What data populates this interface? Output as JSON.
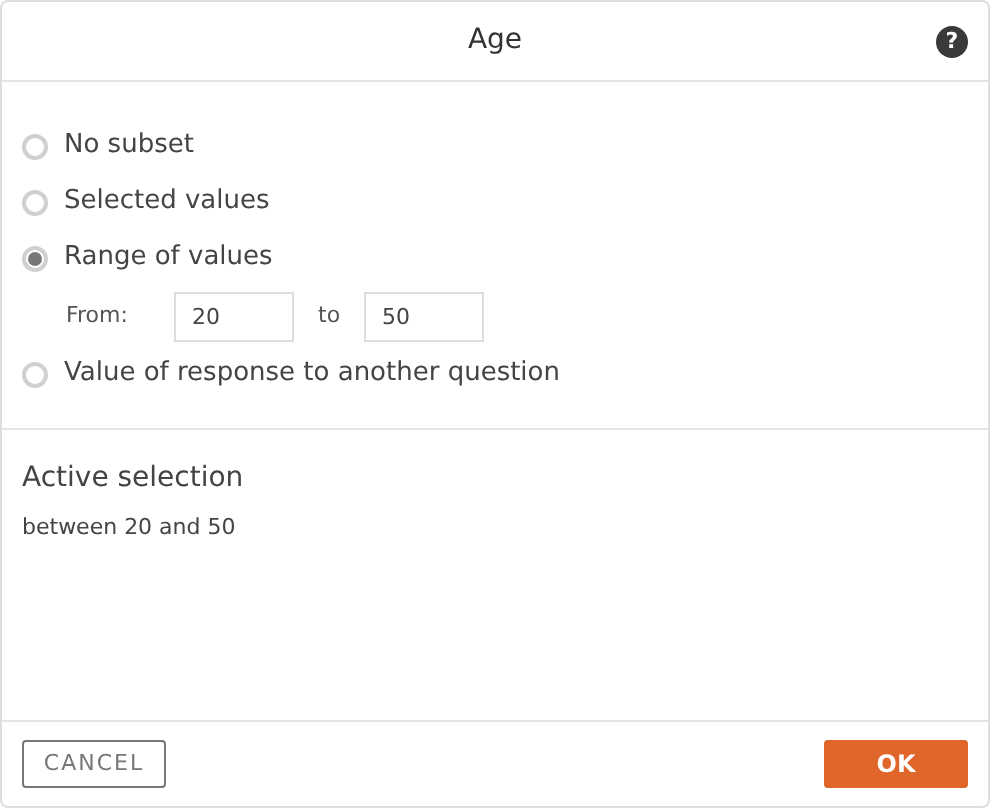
{
  "dialog": {
    "title": "Age",
    "help": "?"
  },
  "options": [
    {
      "label": "No subset",
      "selected": false
    },
    {
      "label": "Selected values",
      "selected": false
    },
    {
      "label": "Range of values",
      "selected": true,
      "range": {
        "from_label": "From:",
        "from_value": "20",
        "to_label": "to",
        "to_value": "50"
      }
    },
    {
      "label": "Value of response to another question",
      "selected": false
    }
  ],
  "active_selection": {
    "heading": "Active selection",
    "text": "between 20 and 50"
  },
  "buttons": [
    {
      "label": "CANCEL",
      "kind": "secondary"
    },
    {
      "label": "OK",
      "kind": "primary"
    }
  ]
}
